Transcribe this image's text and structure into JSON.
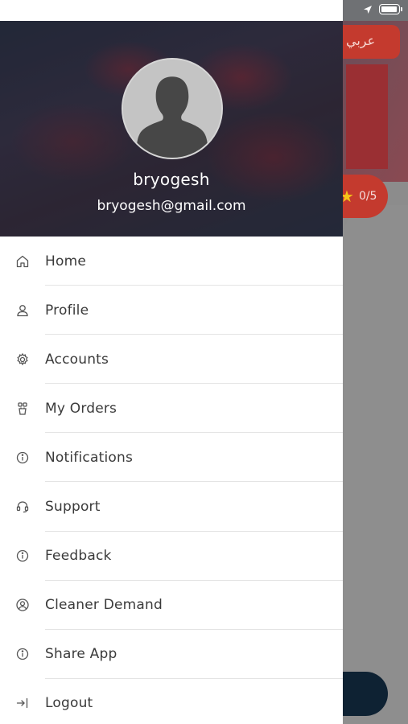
{
  "background": {
    "language_button": "عربي",
    "rating_text": "0/5"
  },
  "drawer": {
    "user_name": "bryogesh",
    "user_email": "bryogesh@gmail.com",
    "items": [
      {
        "label": "Home",
        "icon": "home-icon"
      },
      {
        "label": "Profile",
        "icon": "user-icon"
      },
      {
        "label": "Accounts",
        "icon": "gear-icon"
      },
      {
        "label": "My Orders",
        "icon": "orders-icon"
      },
      {
        "label": "Notifications",
        "icon": "info-icon"
      },
      {
        "label": "Support",
        "icon": "headset-icon"
      },
      {
        "label": "Feedback",
        "icon": "info-icon"
      },
      {
        "label": "Cleaner Demand",
        "icon": "user-circle-icon"
      },
      {
        "label": "Share App",
        "icon": "info-icon"
      },
      {
        "label": "Logout",
        "icon": "logout-icon"
      }
    ]
  },
  "colors": {
    "accent_red": "#c43a2e",
    "dark_button": "#0e2233"
  }
}
